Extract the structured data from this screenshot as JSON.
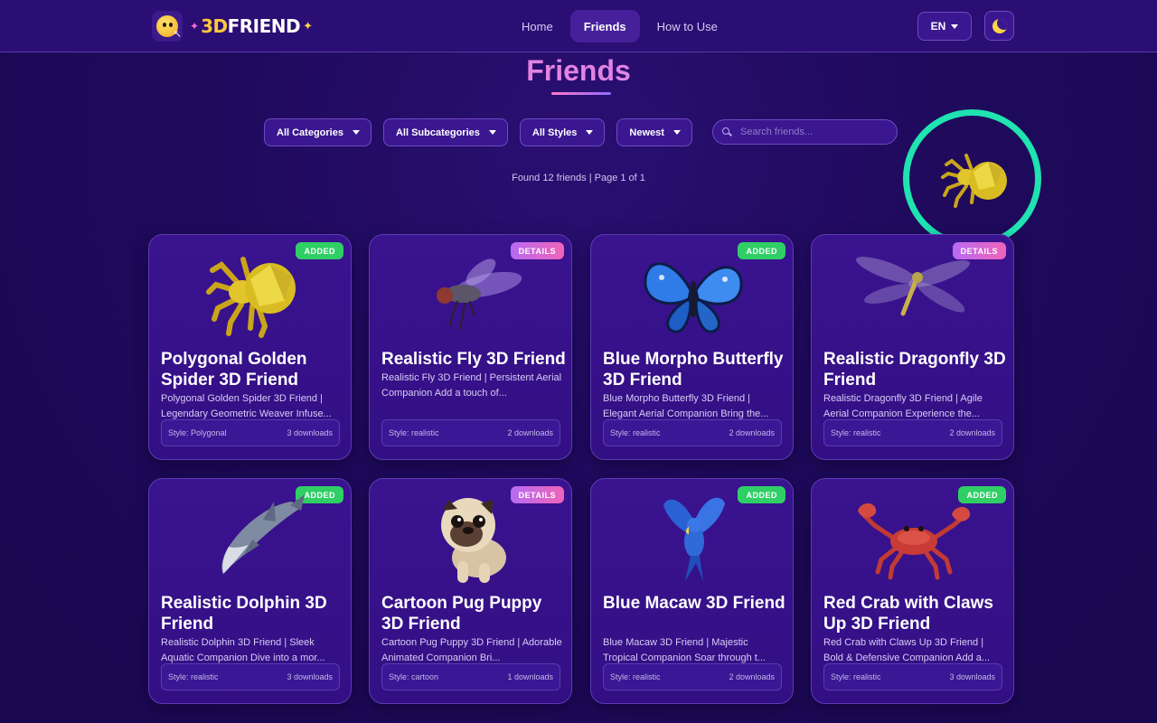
{
  "header": {
    "logo_text_a": "3D",
    "logo_text_b": "FRIEND",
    "nav": [
      {
        "label": "Home",
        "active": false
      },
      {
        "label": "Friends",
        "active": true
      },
      {
        "label": "How to Use",
        "active": false
      }
    ],
    "language": "EN",
    "theme_icon": "moon-icon"
  },
  "page": {
    "title": "Friends",
    "found_text": "Found 12 friends | Page 1 of 1"
  },
  "filters": {
    "categories": "All Categories",
    "subcategories": "All Subcategories",
    "styles": "All Styles",
    "sort": "Newest",
    "search_placeholder": "Search friends..."
  },
  "colors": {
    "background": "#1f0a5c",
    "card": "#3a138f",
    "added_badge": "#2fcf66",
    "highlight_ring": "#1fe3b0",
    "title_gradient_start": "#ff7ac8"
  },
  "cards": [
    {
      "title": "Polygonal Golden Spider 3D Friend",
      "desc": "Polygonal Golden Spider 3D Friend | Legendary Geometric Weaver Infuse...",
      "badge": "ADDED",
      "style": "Style: Polygonal",
      "downloads": "3 downloads",
      "icon": "golden-spider-icon"
    },
    {
      "title": "Realistic Fly 3D Friend",
      "desc": "Realistic Fly 3D Friend | Persistent Aerial Companion Add a touch of...",
      "badge": "DETAILS",
      "style": "Style: realistic",
      "downloads": "2 downloads",
      "icon": "fly-icon"
    },
    {
      "title": "Blue Morpho Butterfly 3D Friend",
      "desc": "Blue Morpho Butterfly 3D Friend | Elegant Aerial Companion Bring the...",
      "badge": "ADDED",
      "style": "Style: realistic",
      "downloads": "2 downloads",
      "icon": "butterfly-icon"
    },
    {
      "title": "Realistic Dragonfly 3D Friend",
      "desc": "Realistic Dragonfly 3D Friend | Agile Aerial Companion Experience the...",
      "badge": "DETAILS",
      "style": "Style: realistic",
      "downloads": "2 downloads",
      "icon": "dragonfly-icon"
    },
    {
      "title": "Realistic Dolphin 3D Friend",
      "desc": "Realistic Dolphin 3D Friend | Sleek Aquatic Companion Dive into a mor...",
      "badge": "ADDED",
      "style": "Style: realistic",
      "downloads": "3 downloads",
      "icon": "dolphin-icon"
    },
    {
      "title": "Cartoon Pug Puppy 3D Friend",
      "desc": "Cartoon Pug Puppy 3D Friend | Adorable Animated Companion Bri...",
      "badge": "DETAILS",
      "style": "Style: cartoon",
      "downloads": "1 downloads",
      "icon": "pug-icon"
    },
    {
      "title": "Blue Macaw 3D Friend",
      "desc": "Blue Macaw 3D Friend | Majestic Tropical Companion Soar through t...",
      "badge": "ADDED",
      "style": "Style: realistic",
      "downloads": "2 downloads",
      "icon": "macaw-icon"
    },
    {
      "title": "Red Crab with Claws Up 3D Friend",
      "desc": "Red Crab with Claws Up 3D Friend | Bold & Defensive Companion Add a...",
      "badge": "ADDED",
      "style": "Style: realistic",
      "downloads": "3 downloads",
      "icon": "crab-icon"
    }
  ],
  "floating_friend": {
    "icon": "golden-spider-icon"
  }
}
